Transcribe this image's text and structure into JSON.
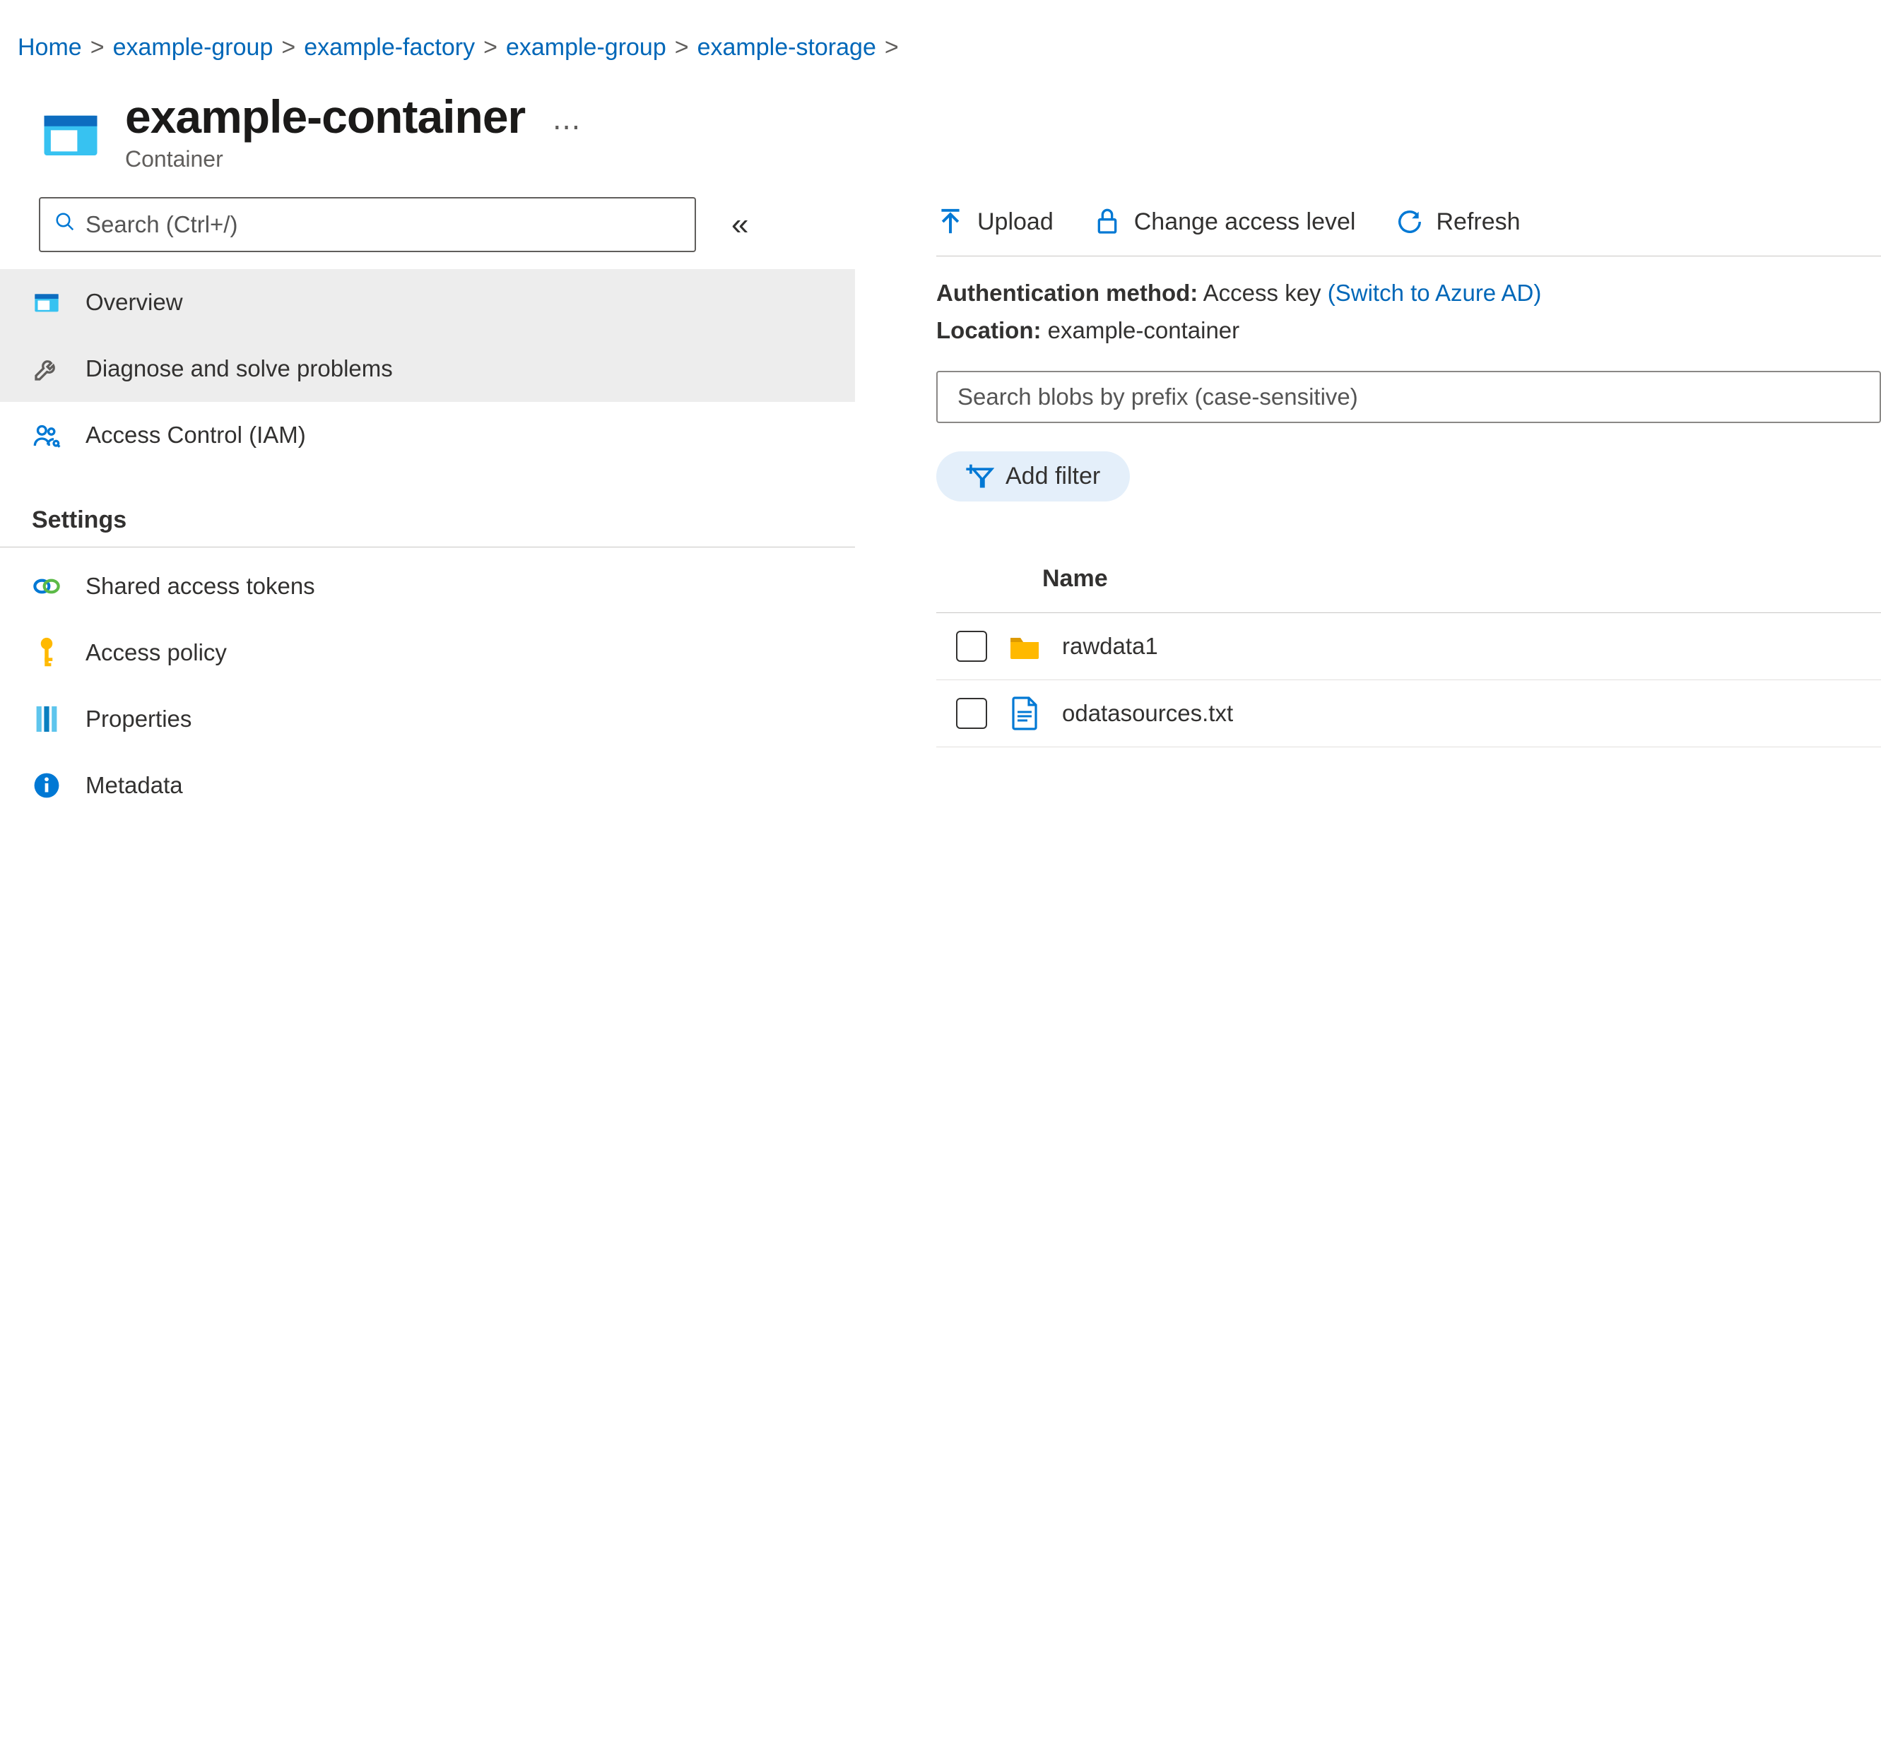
{
  "breadcrumb": [
    {
      "label": "Home"
    },
    {
      "label": "example-group"
    },
    {
      "label": "example-factory"
    },
    {
      "label": "example-group"
    },
    {
      "label": "example-storage"
    }
  ],
  "header": {
    "title": "example-container",
    "subtitle": "Container"
  },
  "sidebar": {
    "search_placeholder": "Search (Ctrl+/)",
    "items": {
      "overview": "Overview",
      "diagnose": "Diagnose and solve problems",
      "iam": "Access Control (IAM)"
    },
    "section_settings": "Settings",
    "settings": {
      "shared_tokens": "Shared access tokens",
      "access_policy": "Access policy",
      "properties": "Properties",
      "metadata": "Metadata"
    }
  },
  "toolbar": {
    "upload": "Upload",
    "change_access": "Change access level",
    "refresh": "Refresh"
  },
  "auth": {
    "label": "Authentication method:",
    "value": "Access key",
    "switch": "(Switch to Azure AD)"
  },
  "location": {
    "label": "Location:",
    "value": "example-container"
  },
  "blob_search_placeholder": "Search blobs by prefix (case-sensitive)",
  "add_filter": "Add filter",
  "table": {
    "col_name": "Name",
    "rows": [
      {
        "type": "folder",
        "name": "rawdata1"
      },
      {
        "type": "file",
        "name": "odatasources.txt"
      }
    ]
  }
}
